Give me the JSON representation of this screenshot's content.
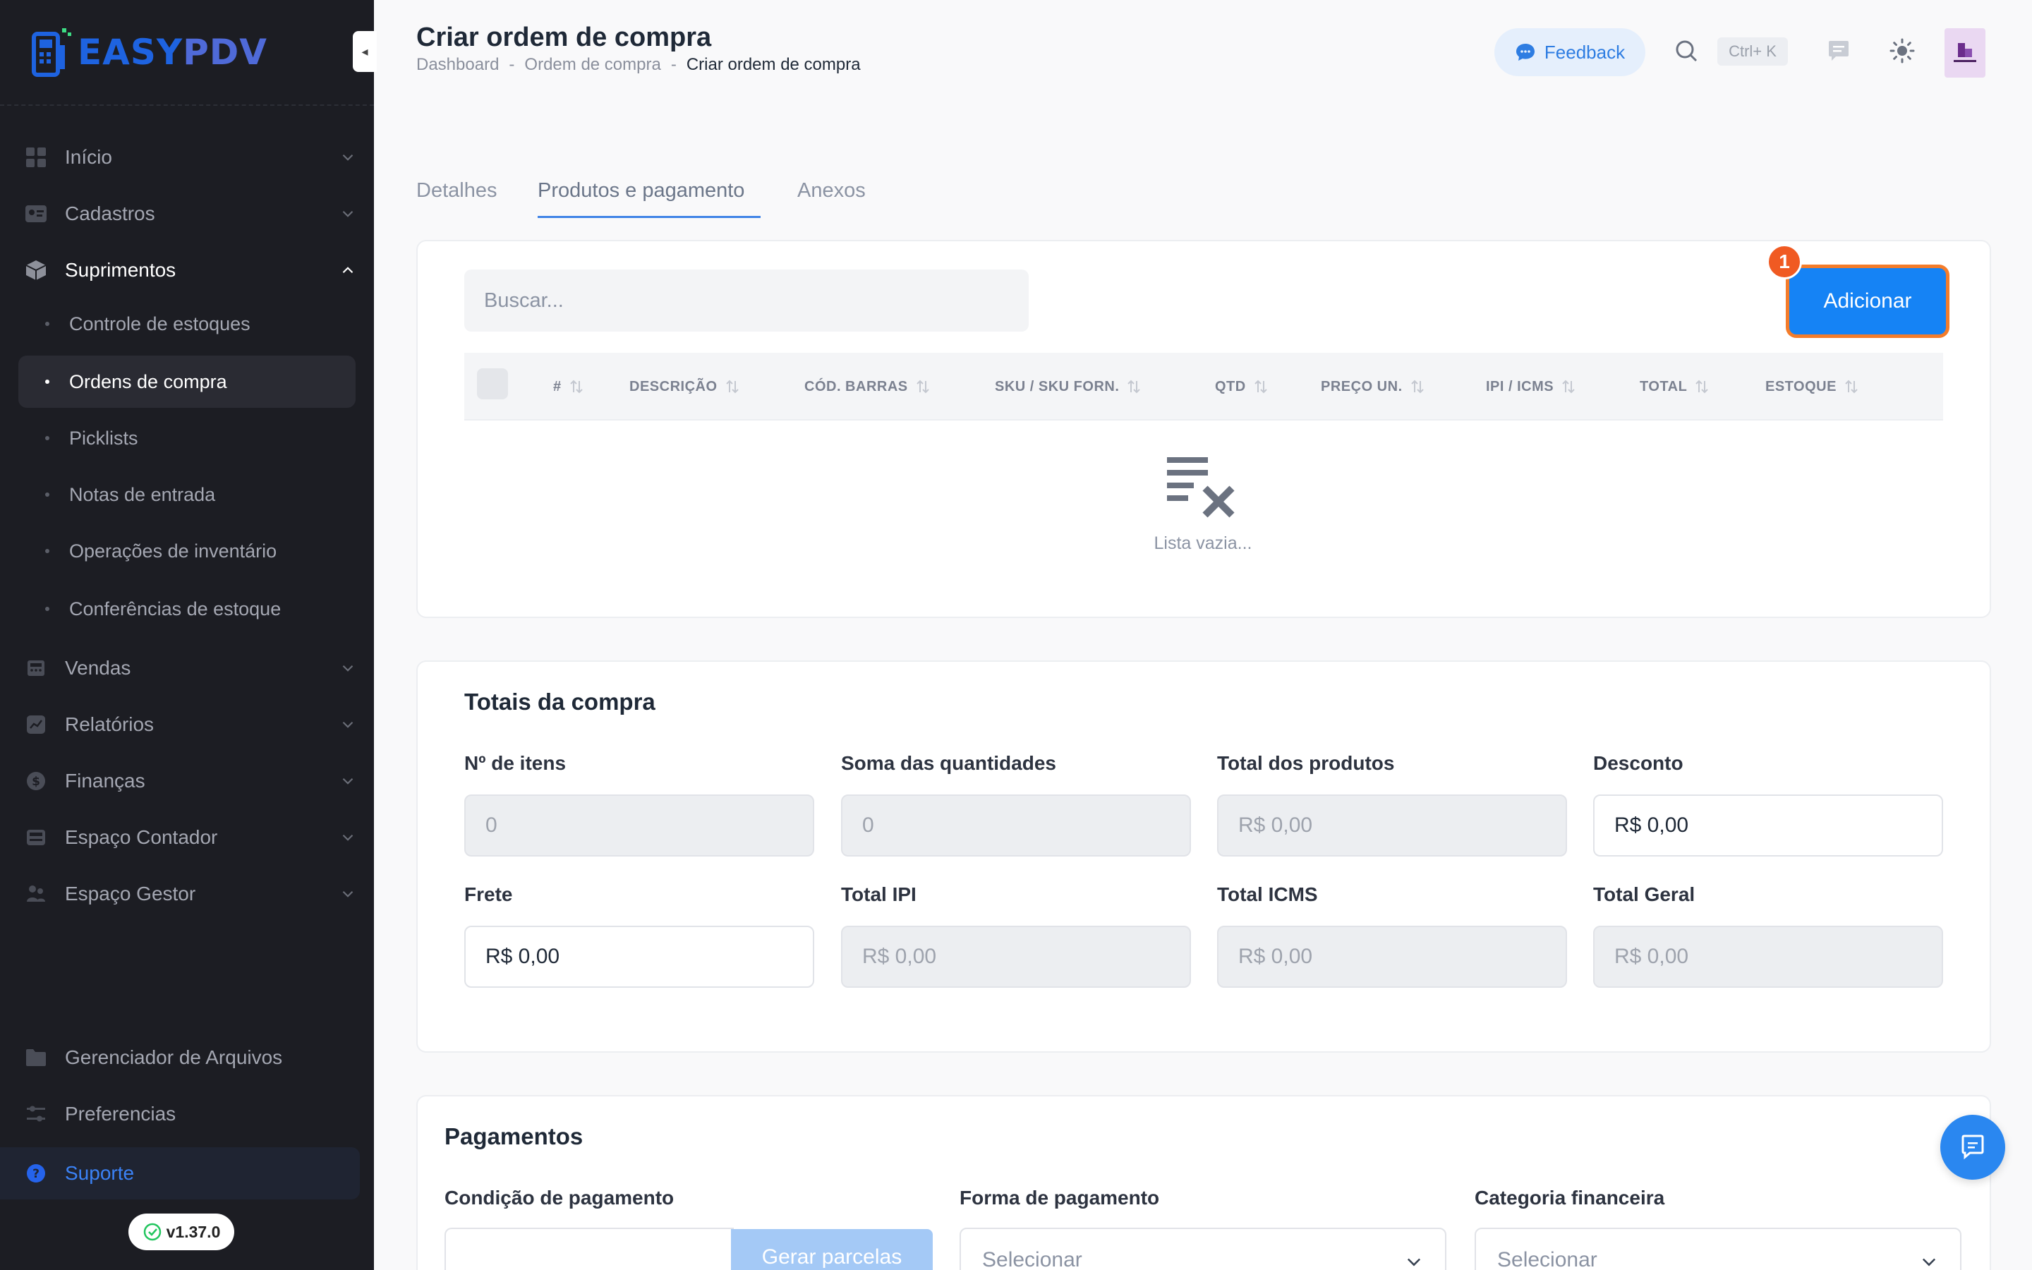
{
  "brand": {
    "logo_text_a": "EASY",
    "logo_text_b": "PDV",
    "colors": {
      "primary": "#1583f5",
      "sidebar_bg": "#1c1d23",
      "highlight": "#f47c2a"
    }
  },
  "sidebar": {
    "items": [
      {
        "label": "Início",
        "icon": "grid-icon"
      },
      {
        "label": "Cadastros",
        "icon": "id-card-icon"
      },
      {
        "label": "Suprimentos",
        "icon": "box-icon",
        "open": true
      },
      {
        "label": "Vendas",
        "icon": "register-icon"
      },
      {
        "label": "Relatórios",
        "icon": "chart-icon"
      },
      {
        "label": "Finanças",
        "icon": "dollar-icon"
      },
      {
        "label": "Espaço Contador",
        "icon": "calculator-icon"
      },
      {
        "label": "Espaço Gestor",
        "icon": "users-icon"
      }
    ],
    "sub_items": [
      {
        "label": "Controle de estoques"
      },
      {
        "label": "Ordens de compra",
        "active": true
      },
      {
        "label": "Picklists"
      },
      {
        "label": "Notas de entrada"
      },
      {
        "label": "Operações de inventário"
      },
      {
        "label": "Conferências de estoque"
      }
    ],
    "bottom": [
      {
        "label": "Gerenciador de Arquivos",
        "icon": "folder-icon"
      },
      {
        "label": "Preferencias",
        "icon": "sliders-icon"
      }
    ],
    "support_label": "Suporte",
    "version": "v1.37.0"
  },
  "header": {
    "title": "Criar ordem de compra",
    "breadcrumb": [
      "Dashboard",
      "Ordem de compra",
      "Criar ordem de compra"
    ],
    "breadcrumb_sep": "-",
    "feedback_label": "Feedback",
    "shortcut": "Ctrl+ K"
  },
  "tabs": [
    {
      "label": "Detalhes"
    },
    {
      "label": "Produtos e pagamento",
      "active": true
    },
    {
      "label": "Anexos"
    }
  ],
  "products": {
    "search_placeholder": "Buscar...",
    "add_label": "Adicionar",
    "badge": "1",
    "columns": [
      "#",
      "DESCRIÇÃO",
      "CÓD. BARRAS",
      "SKU / SKU FORN.",
      "QTD",
      "PREÇO UN.",
      "IPI / ICMS",
      "TOTAL",
      "ESTOQUE"
    ],
    "empty_text": "Lista vazia..."
  },
  "totals": {
    "title": "Totais da compra",
    "fields": [
      {
        "label": "Nº de itens",
        "value": "0",
        "disabled": true
      },
      {
        "label": "Soma das quantidades",
        "value": "0",
        "disabled": true
      },
      {
        "label": "Total dos produtos",
        "value": "R$ 0,00",
        "disabled": true
      },
      {
        "label": "Desconto",
        "value": "R$ 0,00",
        "disabled": false
      },
      {
        "label": "Frete",
        "value": "R$ 0,00",
        "disabled": false
      },
      {
        "label": "Total IPI",
        "value": "R$ 0,00",
        "disabled": true
      },
      {
        "label": "Total ICMS",
        "value": "R$ 0,00",
        "disabled": true
      },
      {
        "label": "Total Geral",
        "value": "R$ 0,00",
        "disabled": true
      }
    ]
  },
  "payments": {
    "title": "Pagamentos",
    "condition_label": "Condição de pagamento",
    "generate_label": "Gerar parcelas",
    "method_label": "Forma de pagamento",
    "method_value": "Selecionar",
    "category_label": "Categoria financeira",
    "category_value": "Selecionar"
  }
}
